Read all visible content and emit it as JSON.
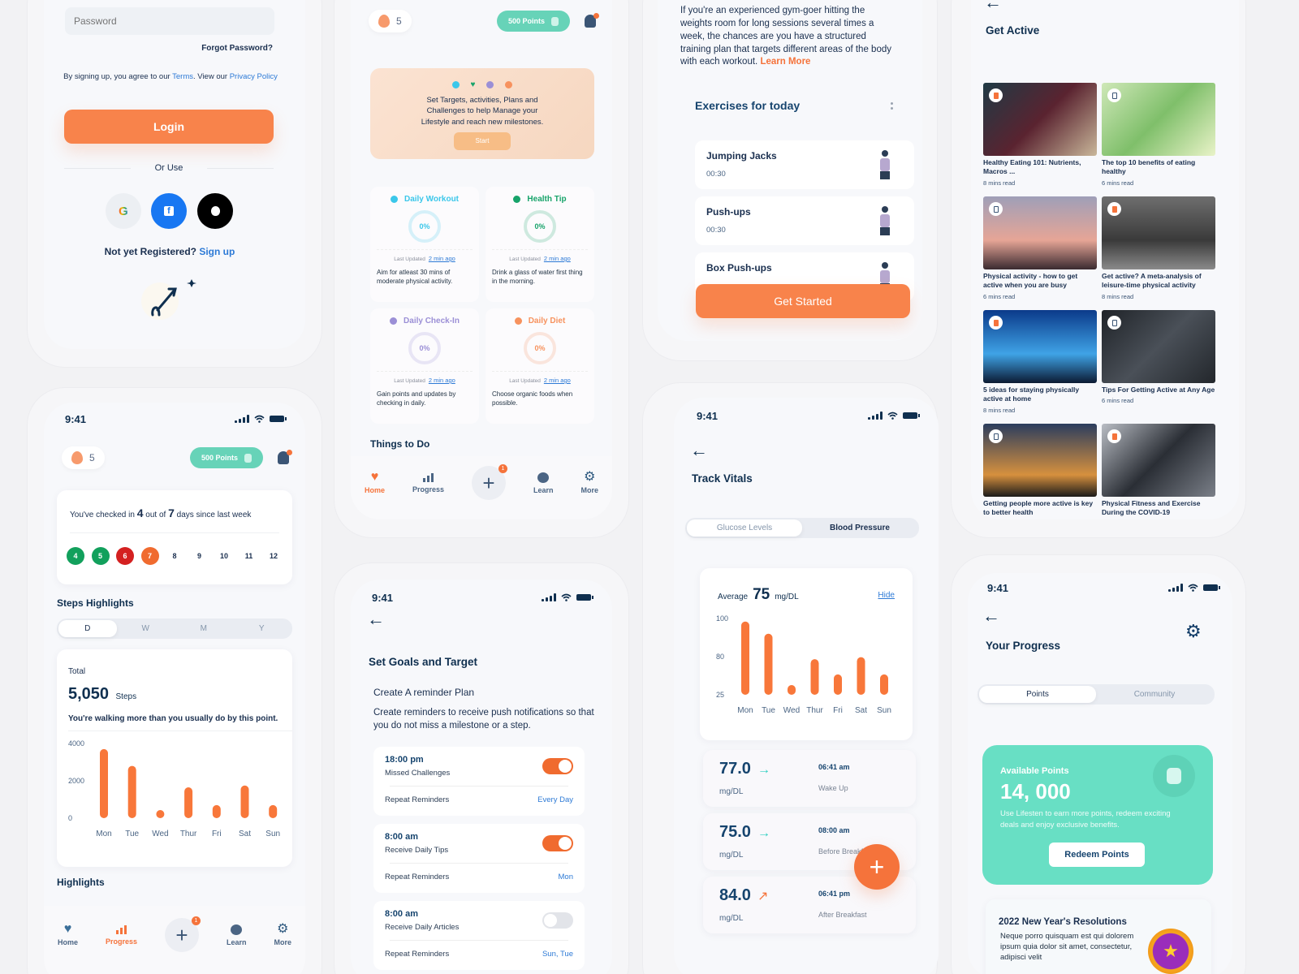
{
  "status": {
    "time": "9:41"
  },
  "colors": {
    "accent": "#f8834b",
    "teal": "#67d3b8",
    "navy": "#0f2f4f",
    "link": "#2d7ad6"
  },
  "login": {
    "password_placeholder": "Password",
    "forgot": "Forgot Password?",
    "terms_prefix": "By signing up, you agree to our ",
    "terms_link": "Terms",
    "terms_mid": ". View our ",
    "privacy_link": "Privacy Policy",
    "login_button": "Login",
    "or_use": "Or Use",
    "social": [
      "google",
      "facebook",
      "apple"
    ],
    "not_registered": "Not yet Registered?",
    "signup": "Sign up"
  },
  "progress_screen": {
    "streak": "5",
    "points_pill": "500 Points",
    "checkin_prefix": "You've checked in ",
    "checkin_count": "4",
    "checkin_mid": " out of ",
    "checkin_total": "7",
    "checkin_suffix": " days since last week",
    "days": [
      {
        "n": "4",
        "color": "#12a05c"
      },
      {
        "n": "5",
        "color": "#12a05c"
      },
      {
        "n": "6",
        "color": "#d42020"
      },
      {
        "n": "7",
        "color": "#f06b2f"
      },
      {
        "n": "8",
        "color": ""
      },
      {
        "n": "9",
        "color": ""
      },
      {
        "n": "10",
        "color": ""
      },
      {
        "n": "11",
        "color": ""
      },
      {
        "n": "12",
        "color": ""
      }
    ],
    "steps_title": "Steps Highlights",
    "periods": [
      "D",
      "W",
      "M",
      "Y"
    ],
    "active_period": "D",
    "total_label": "Total",
    "total_value": "5,050",
    "total_unit": "Steps",
    "message": "You're walking more than you usually do by this point.",
    "highlights": "Highlights"
  },
  "steps_chart": {
    "type": "bar",
    "categories": [
      "Mon",
      "Tue",
      "Wed",
      "Thur",
      "Fri",
      "Sat",
      "Sun"
    ],
    "values": [
      3700,
      2800,
      300,
      1650,
      700,
      1750,
      700
    ],
    "y_ticks": [
      "4000",
      "2000",
      "0"
    ],
    "ylim": [
      0,
      4000
    ]
  },
  "home_screen": {
    "streak": "5",
    "points_pill": "500 Points",
    "banner_text": "Set Targets, activities, Plans and Challenges to help Manage your Lifestyle and reach new milestones.",
    "banner_button": "Start",
    "tiles": [
      {
        "title": "Daily Workout",
        "percent": "0%",
        "updated_label": "Last Updated",
        "updated": "2 min ago",
        "desc": "Aim for atleast 30 mins of moderate physical activity.",
        "color": "#3bc7ea"
      },
      {
        "title": "Health Tip",
        "percent": "0%",
        "updated_label": "Last Updated",
        "updated": "2 min ago",
        "desc": "Drink a glass of water first thing in the morning.",
        "color": "#17a36a"
      },
      {
        "title": "Daily Check-In",
        "percent": "0%",
        "updated_label": "Last Updated",
        "updated": "2 min ago",
        "desc": "Gain points and updates by checking in daily.",
        "color": "#9b8fd6"
      },
      {
        "title": "Daily Diet",
        "percent": "0%",
        "updated_label": "Last Updated",
        "updated": "2 min ago",
        "desc": "Choose organic foods when possible.",
        "color": "#f7925e"
      }
    ],
    "things_to_do": "Things to Do"
  },
  "nav": [
    {
      "label": "Home",
      "icon": "heart-icon"
    },
    {
      "label": "Progress",
      "icon": "bar-chart-icon"
    },
    {
      "label": "",
      "icon": "plus-icon",
      "badge": "1"
    },
    {
      "label": "Learn",
      "icon": "brain-icon"
    },
    {
      "label": "More",
      "icon": "gear-icon"
    }
  ],
  "goals_screen": {
    "title": "Set Goals and Target",
    "subtitle": "Create A reminder Plan",
    "desc": "Create reminders to receive push notifications so that you do not miss a milestone or a step.",
    "reminders": [
      {
        "time": "18:00 pm",
        "name": "Missed Challenges",
        "repeat_label": "Repeat Reminders",
        "repeat": "Every Day",
        "on": true
      },
      {
        "time": "8:00 am",
        "name": "Receive Daily Tips",
        "repeat_label": "Repeat Reminders",
        "repeat": "Mon",
        "on": true
      },
      {
        "time": "8:00 am",
        "name": "Receive Daily Articles",
        "repeat_label": "Repeat Reminders",
        "repeat": "Sun, Tue",
        "on": false
      }
    ]
  },
  "workout_screen": {
    "intro": "If you're an experienced gym-goer hitting the weights room for long sessions several times a week, the chances are you have a structured training plan that targets different areas of the body with each workout.",
    "learn_more": "Learn More",
    "section_title": "Exercises for today",
    "exercises": [
      {
        "name": "Jumping Jacks",
        "time": "00:30"
      },
      {
        "name": "Push-ups",
        "time": "00:30"
      },
      {
        "name": "Box Push-ups",
        "time": ""
      }
    ],
    "get_started": "Get Started"
  },
  "vitals_screen": {
    "title": "Track Vitals",
    "tabs": [
      "Glucose Levels",
      "Blood Pressure"
    ],
    "active_tab": "Glucose Levels",
    "average_label": "Average",
    "average_value": "75",
    "average_unit": "mg/DL",
    "hide": "Hide",
    "readings": [
      {
        "value": "77.0",
        "trend": "→",
        "trend_color": "#2fcfc0",
        "unit": "mg/DL",
        "time": "06:41 am",
        "label": "Wake Up"
      },
      {
        "value": "75.0",
        "trend": "→",
        "trend_color": "#2fcfc0",
        "unit": "mg/DL",
        "time": "08:00 am",
        "label": "Before Breakfast"
      },
      {
        "value": "84.0",
        "trend": "↗",
        "trend_color": "#f5733b",
        "unit": "mg/DL",
        "time": "06:41 pm",
        "label": "After Breakfast"
      }
    ]
  },
  "glucose_chart": {
    "type": "bar",
    "categories": [
      "Mon",
      "Tue",
      "Wed",
      "Thur",
      "Fri",
      "Sat",
      "Sun"
    ],
    "values": [
      97,
      85,
      33,
      60,
      45,
      62,
      45
    ],
    "y_ticks": [
      "100",
      "80",
      "25"
    ],
    "ylim": [
      25,
      100
    ]
  },
  "articles_screen": {
    "title": "Get Active",
    "articles": [
      {
        "title": "Healthy Eating 101: Nutrients, Macros ...",
        "meta": "8 mins read",
        "saved": true,
        "bg": "linear-gradient(135deg,#1f3a45,#5a2330 50%,#c9b79a)"
      },
      {
        "title": "The top 10 benefits of eating healthy",
        "meta": "6 mins read",
        "saved": false,
        "bg": "linear-gradient(135deg,#cfe8b8,#7fbf6a 50%,#e9f3c8)"
      },
      {
        "title": "Physical activity - how to get active when you are busy",
        "meta": "6 mins read",
        "saved": false,
        "bg": "linear-gradient(180deg,#9f9fb8,#e6a596 60%,#3a2a30)"
      },
      {
        "title": "Get active? A meta-analysis of leisure-time physical activity",
        "meta": "8 mins read",
        "saved": true,
        "bg": "linear-gradient(180deg,#6e6e6e,#3a3a3a 60%,#8a8a8a)"
      },
      {
        "title": "5 ideas for staying physically active at home",
        "meta": "8 mins read",
        "saved": true,
        "bg": "linear-gradient(180deg,#0b3a8a,#3fa3e6 60%,#0c1a33)"
      },
      {
        "title": "Tips For Getting Active at Any Age",
        "meta": "6 mins read",
        "saved": false,
        "bg": "linear-gradient(135deg,#1f2328,#4a5058 50%,#23272c)"
      },
      {
        "title": "Getting people more active is key to better health",
        "meta": "",
        "saved": false,
        "bg": "linear-gradient(180deg,#2b3d5e,#d6903e 70%,#1a1a1a)"
      },
      {
        "title": "Physical Fitness and Exercise During the COVID-19",
        "meta": "",
        "saved": true,
        "bg": "linear-gradient(135deg,#b9bdc4,#2a2e35 50%,#7a7f88)"
      }
    ]
  },
  "points_screen": {
    "title": "Your Progress",
    "tabs": [
      "Points",
      "Community"
    ],
    "active_tab": "Points",
    "available_label": "Available Points",
    "available_value": "14, 000",
    "available_desc": "Use Lifesten to earn more points, redeem exciting deals and enjoy exclusive benefits.",
    "redeem": "Redeem Points",
    "resolution_title": "2022 New Year's Resolutions",
    "resolution_desc": "Neque porro quisquam est qui dolorem ipsum quia dolor sit amet, consectetur, adipisci velit"
  }
}
